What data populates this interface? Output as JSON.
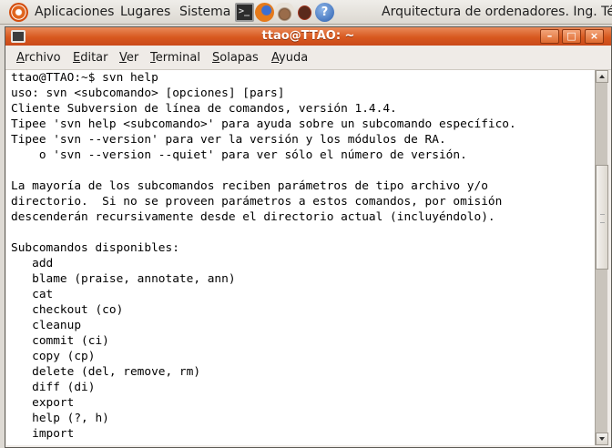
{
  "panel": {
    "menus": [
      "Aplicaciones",
      "Lugares",
      "Sistema"
    ],
    "launcher_icons": [
      "terminal-icon",
      "firefox-icon",
      "gimp-icon",
      "bug-icon",
      "help-icon"
    ],
    "help_glyph": "?",
    "taskbar_text": "Arquitectura de ordenadores. Ing. Técnic"
  },
  "window": {
    "title": "ttao@TTAO: ~",
    "buttons": {
      "minimize": "–",
      "maximize": "□",
      "close": "×"
    },
    "menubar": [
      {
        "mnemonic": "A",
        "rest": "rchivo"
      },
      {
        "mnemonic": "E",
        "rest": "ditar"
      },
      {
        "mnemonic": "V",
        "rest": "er"
      },
      {
        "mnemonic": "T",
        "rest": "erminal"
      },
      {
        "mnemonic": "S",
        "rest": "olapas"
      },
      {
        "mnemonic": "A",
        "rest": "yuda"
      }
    ]
  },
  "terminal": {
    "lines": [
      "ttao@TTAO:~$ svn help",
      "uso: svn <subcomando> [opciones] [pars]",
      "Cliente Subversion de línea de comandos, versión 1.4.4.",
      "Tipee 'svn help <subcomando>' para ayuda sobre un subcomando específico.",
      "Tipee 'svn --version' para ver la versión y los módulos de RA.",
      "    o 'svn --version --quiet' para ver sólo el número de versión.",
      "",
      "La mayoría de los subcomandos reciben parámetros de tipo archivo y/o",
      "directorio.  Si no se proveen parámetros a estos comandos, por omisión",
      "descenderán recursivamente desde el directorio actual (incluyéndolo).",
      "",
      "Subcomandos disponibles:",
      "   add",
      "   blame (praise, annotate, ann)",
      "   cat",
      "   checkout (co)",
      "   cleanup",
      "   commit (ci)",
      "   copy (cp)",
      "   delete (del, remove, rm)",
      "   diff (di)",
      "   export",
      "   help (?, h)",
      "   import"
    ]
  },
  "scrollbar": {
    "position_fraction": 0.37,
    "visible_fraction": 0.3
  }
}
